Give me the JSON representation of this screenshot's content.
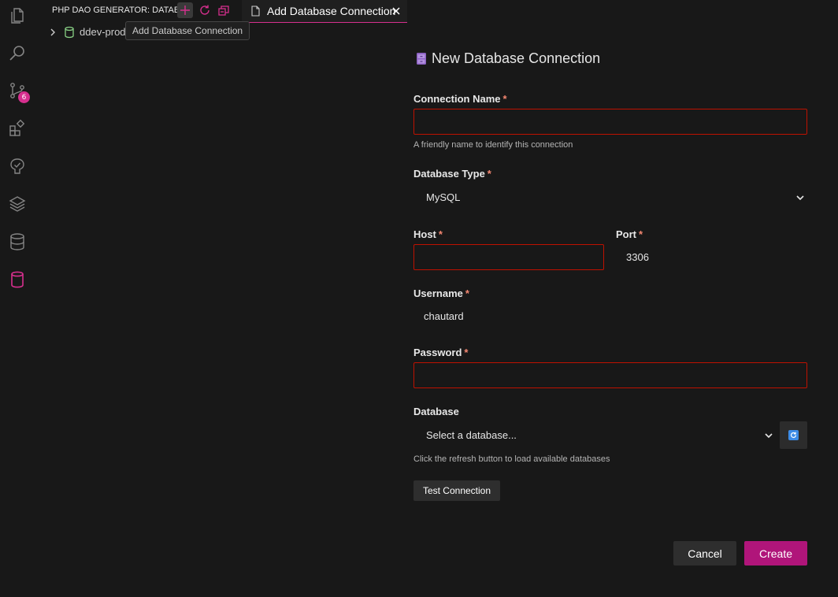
{
  "colors": {
    "accent": "#d62f8e",
    "primary_button": "#b0157a",
    "error_border": "#be1100",
    "required_star": "#f48771",
    "background": "#181818"
  },
  "activity_bar": {
    "icons": [
      "explorer-icon",
      "search-icon",
      "source-control-icon",
      "extensions-icon",
      "testing-icon",
      "layers-icon",
      "database-icon",
      "php-dao-database-icon"
    ],
    "source_control_badge": "6"
  },
  "sidebar": {
    "title": "PHP DAO GENERATOR: DATAB...",
    "actions": [
      "add-connection-icon",
      "refresh-icon",
      "collapse-all-icon"
    ],
    "tree": [
      {
        "label": "ddev-prod",
        "icon": "database-icon"
      }
    ],
    "tooltip": "Add Database Connection"
  },
  "tab": {
    "label": "Add Database Connection"
  },
  "form": {
    "title": "New Database Connection",
    "required_marker": "*",
    "connection_name": {
      "label": "Connection Name",
      "value": "",
      "help": "A friendly name to identify this connection"
    },
    "database_type": {
      "label": "Database Type",
      "value": "MySQL"
    },
    "host": {
      "label": "Host",
      "value": ""
    },
    "port": {
      "label": "Port",
      "value": "3306"
    },
    "username": {
      "label": "Username",
      "value": "chautard"
    },
    "password": {
      "label": "Password",
      "value": ""
    },
    "database": {
      "label": "Database",
      "placeholder": "Select a database...",
      "help": "Click the refresh button to load available databases"
    },
    "test_connection_label": "Test Connection",
    "cancel_label": "Cancel",
    "create_label": "Create"
  }
}
